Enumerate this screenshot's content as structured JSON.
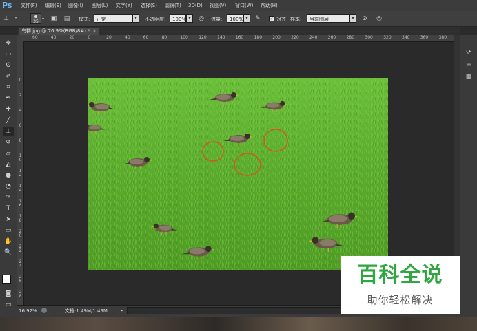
{
  "app": {
    "logo": "Ps"
  },
  "menu": [
    "文件(F)",
    "编辑(E)",
    "图像(I)",
    "图层(L)",
    "文字(Y)",
    "选择(S)",
    "滤镜(T)",
    "3D(D)",
    "视图(V)",
    "窗口(W)",
    "帮助(H)"
  ],
  "options": {
    "brush_size": "35",
    "mode_label": "模式:",
    "mode_value": "正常",
    "opacity_label": "不透明度:",
    "opacity_value": "100%",
    "flow_label": "流量:",
    "flow_value": "100%",
    "aligned_label": "对齐",
    "aligned_checked": "✓",
    "sample_label": "样本:",
    "sample_value": "当前图层"
  },
  "document": {
    "tab_title": "鸟群.jpg @ 76.9%(RGB/8#) *",
    "tab_close": "×"
  },
  "ruler": {
    "top_ticks": [
      "60",
      "40",
      "20",
      "0",
      "20",
      "40",
      "60",
      "80",
      "100",
      "120",
      "140",
      "160",
      "180",
      "200",
      "220",
      "240",
      "260",
      "280",
      "300",
      "320",
      "340",
      "360",
      "380",
      "400"
    ],
    "left_ticks": [
      "0",
      "2",
      "4",
      "6",
      "8",
      "1 0",
      "1 2",
      "1 4",
      "1 6",
      "1 8",
      "2 0",
      "2 2",
      "2 4",
      "2 6",
      "2 8",
      "3 0"
    ]
  },
  "status": {
    "zoom": "76.92%",
    "doc_info": "文档:1.49M/1.49M"
  },
  "watermark": {
    "title": "百科全说",
    "subtitle": "助你轻松解决"
  },
  "colors": {
    "accent_ps": "#6fb8f2",
    "watermark_green": "#2fa640",
    "marker_circle": "#d8541f"
  }
}
